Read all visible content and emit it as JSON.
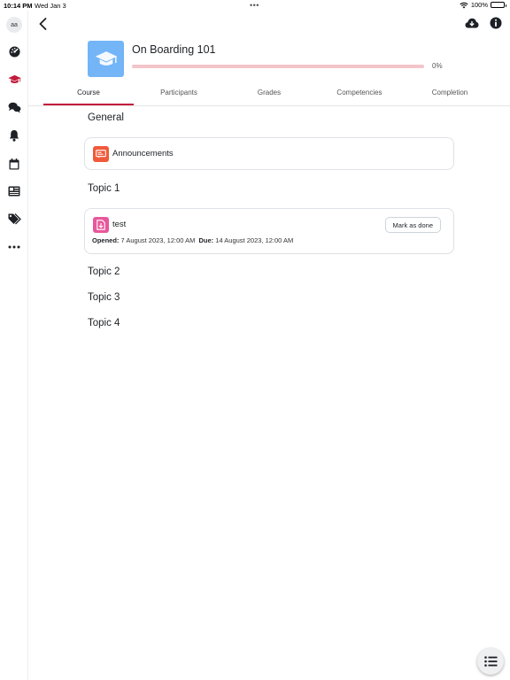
{
  "status_bar": {
    "time": "10:14 PM",
    "date": "Wed Jan 3",
    "battery": "100%"
  },
  "sidebar": {
    "avatar_initials": "aa",
    "items": [
      {
        "icon": "dashboard-icon"
      },
      {
        "icon": "graduation-cap-icon",
        "active": true
      },
      {
        "icon": "messages-icon"
      },
      {
        "icon": "bell-icon"
      },
      {
        "icon": "calendar-icon"
      },
      {
        "icon": "news-icon"
      },
      {
        "icon": "tags-icon"
      },
      {
        "icon": "more-icon"
      }
    ]
  },
  "header": {
    "back_icon": "chevron-left-icon",
    "download_icon": "cloud-download-icon",
    "info_icon": "info-icon"
  },
  "course": {
    "title": "On Boarding 101",
    "progress_label": "0%",
    "progress_fraction": 0,
    "image_icon": "graduation-cap-icon",
    "image_color": "#73b5f7"
  },
  "tabs": [
    {
      "label": "Course",
      "active": true
    },
    {
      "label": "Participants"
    },
    {
      "label": "Grades"
    },
    {
      "label": "Competencies"
    },
    {
      "label": "Completion"
    }
  ],
  "sections": {
    "general": {
      "title": "General",
      "module": {
        "name": "Announcements",
        "icon": "forum-icon",
        "color": "#f05a3a"
      }
    },
    "topic1": {
      "title": "Topic 1",
      "module": {
        "name": "test",
        "icon": "assignment-icon",
        "color": "#e8579b",
        "button_label": "Mark as done",
        "opened_label": "Opened:",
        "opened_value": "7 August 2023, 12:00 AM",
        "due_label": "Due:",
        "due_value": "14 August 2023, 12:00 AM"
      }
    },
    "topic2": {
      "title": "Topic 2"
    },
    "topic3": {
      "title": "Topic 3"
    },
    "topic4": {
      "title": "Topic 4"
    }
  },
  "fab": {
    "icon": "list-icon"
  },
  "colors": {
    "accent": "#c31b3a",
    "progress_track": "#f4c4cb"
  }
}
